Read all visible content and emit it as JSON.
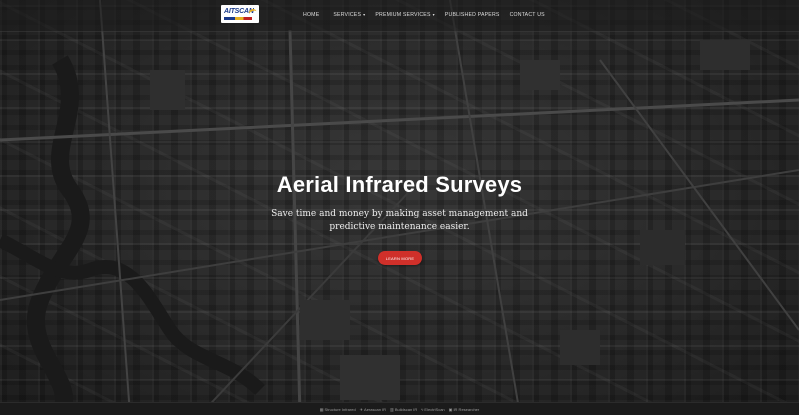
{
  "brand": {
    "logo_text": "AITSCAN"
  },
  "nav": {
    "items": [
      {
        "label": "HOME",
        "has_caret": false
      },
      {
        "label": "SERVICES",
        "has_caret": true
      },
      {
        "label": "PREMIUM SERVICES",
        "has_caret": true
      },
      {
        "label": "PUBLISHED PAPERS",
        "has_caret": false
      },
      {
        "label": "CONTACT US",
        "has_caret": false
      }
    ],
    "caret": "▾"
  },
  "hero": {
    "title": "Aerial Infrared Surveys",
    "subtitle": "Save time and money by making asset management and predictive maintenance easier.",
    "cta_label": "LEARN MORE",
    "cta_color": "#d0302a"
  },
  "footer": {
    "items": [
      {
        "icon": "building-icon",
        "glyph": "▦",
        "label": "Structure Infrared"
      },
      {
        "icon": "plane-icon",
        "glyph": "✈",
        "label": "Aerascan IR"
      },
      {
        "icon": "grid-icon",
        "glyph": "▥",
        "label": "Buildscan IR"
      },
      {
        "icon": "bolt-icon",
        "glyph": "ϟ",
        "label": "ElectriScan"
      },
      {
        "icon": "image-icon",
        "glyph": "▣",
        "label": "IR Researcher"
      }
    ]
  }
}
